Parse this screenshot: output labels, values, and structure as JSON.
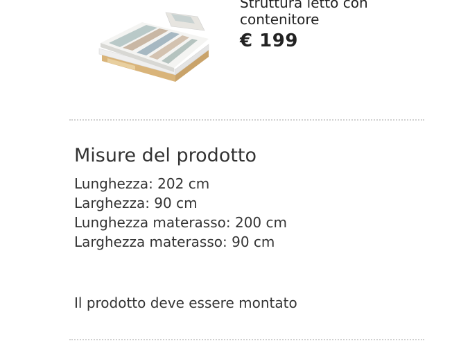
{
  "product": {
    "image_name": "bed-with-storage-photo",
    "name": "Struttura letto con contenitore",
    "price": "€ 199"
  },
  "measures": {
    "title": "Misure del prodotto",
    "items": [
      "Lunghezza: 202 cm",
      "Larghezza: 90 cm",
      "Lunghezza materasso: 200 cm",
      "Larghezza materasso: 90 cm"
    ]
  },
  "assembly_note": "Il prodotto deve essere montato",
  "colors": {
    "text": "#333333",
    "divider": "#d0d0d0",
    "wood": "#e3c491"
  }
}
